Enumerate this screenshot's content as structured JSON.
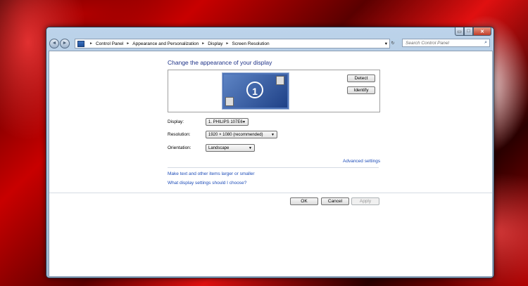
{
  "window": {
    "caption": {
      "minimize": "▭",
      "maximize": "□",
      "close": "✕"
    }
  },
  "navbar": {
    "back": "◄",
    "forward": "►",
    "breadcrumb": [
      "Control Panel",
      "Appearance and Personalization",
      "Display",
      "Screen Resolution"
    ],
    "separator": "►",
    "dropdown_arrow": "▾",
    "refresh": "↻",
    "search_placeholder": "Search Control Panel",
    "search_icon": "⌕"
  },
  "main": {
    "heading": "Change the appearance of your display",
    "monitor_number": "1",
    "detect_label": "Detect",
    "identify_label": "Identify",
    "display": {
      "label": "Display:",
      "value": "1. PHILIPS 107E6"
    },
    "resolution": {
      "label": "Resolution:",
      "value": "1920 × 1080 (recommended)"
    },
    "orientation": {
      "label": "Orientation:",
      "value": "Landscape"
    },
    "advanced_settings": "Advanced settings",
    "link_text_size": "Make text and other items larger or smaller",
    "link_choose": "What display settings should I choose?",
    "ok_label": "OK",
    "cancel_label": "Cancel",
    "apply_label": "Apply"
  },
  "colors": {
    "heading": "#1e3287",
    "link": "#1e4db8",
    "monitor": "#2d55a0"
  }
}
